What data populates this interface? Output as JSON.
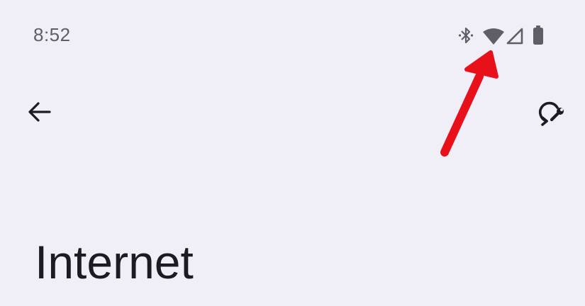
{
  "status_bar": {
    "time": "8:52",
    "icons": [
      "bluetooth-icon",
      "wifi-icon",
      "cellular-signal-icon",
      "battery-icon"
    ]
  },
  "app_bar": {
    "back_icon": "arrow-back-icon",
    "action_icon": "network-reset-icon"
  },
  "page": {
    "title": "Internet"
  },
  "colors": {
    "background": "#f0eff7",
    "status_text": "#5f5d66",
    "title_text": "#1c1b22",
    "annotation": "#e8111a"
  }
}
